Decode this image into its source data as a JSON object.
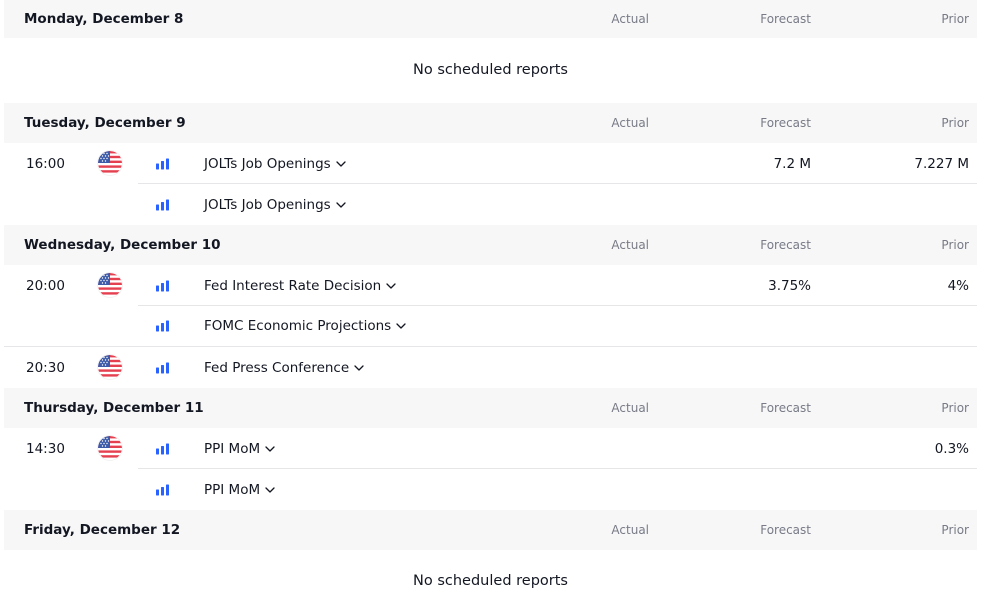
{
  "columns": {
    "actual": "Actual",
    "forecast": "Forecast",
    "prior": "Prior"
  },
  "no_reports": "No scheduled reports",
  "days": [
    {
      "title": "Monday, December 8"
    },
    {
      "title": "Tuesday, December 9"
    },
    {
      "title": "Wednesday, December 10"
    },
    {
      "title": "Thursday, December 11"
    },
    {
      "title": "Friday, December 12"
    }
  ],
  "events": [
    {
      "time": "16:00",
      "country_icon": "us-flag-icon",
      "name": "JOLTs Job Openings",
      "forecast": "7.2 M",
      "prior": "7.227 M"
    },
    {
      "time": "",
      "name": "JOLTs Job Openings",
      "forecast": "",
      "prior": ""
    },
    {
      "time": "20:00",
      "country_icon": "us-flag-icon",
      "name": "Fed Interest Rate Decision",
      "forecast": "3.75%",
      "prior": "4%"
    },
    {
      "time": "",
      "name": "FOMC Economic Projections",
      "forecast": "",
      "prior": ""
    },
    {
      "time": "20:30",
      "country_icon": "us-flag-icon",
      "name": "Fed Press Conference",
      "forecast": "",
      "prior": ""
    },
    {
      "time": "14:30",
      "country_icon": "us-flag-icon",
      "name": "PPI MoM",
      "forecast": "",
      "prior": "0.3%"
    },
    {
      "time": "",
      "name": "PPI MoM",
      "forecast": "",
      "prior": ""
    }
  ],
  "colors": {
    "importance": "#2962ff",
    "header_bg": "#f7f7f8",
    "muted_text": "#787b86",
    "flag_red": "#e4404f",
    "flag_blue": "#3c5ba8"
  }
}
